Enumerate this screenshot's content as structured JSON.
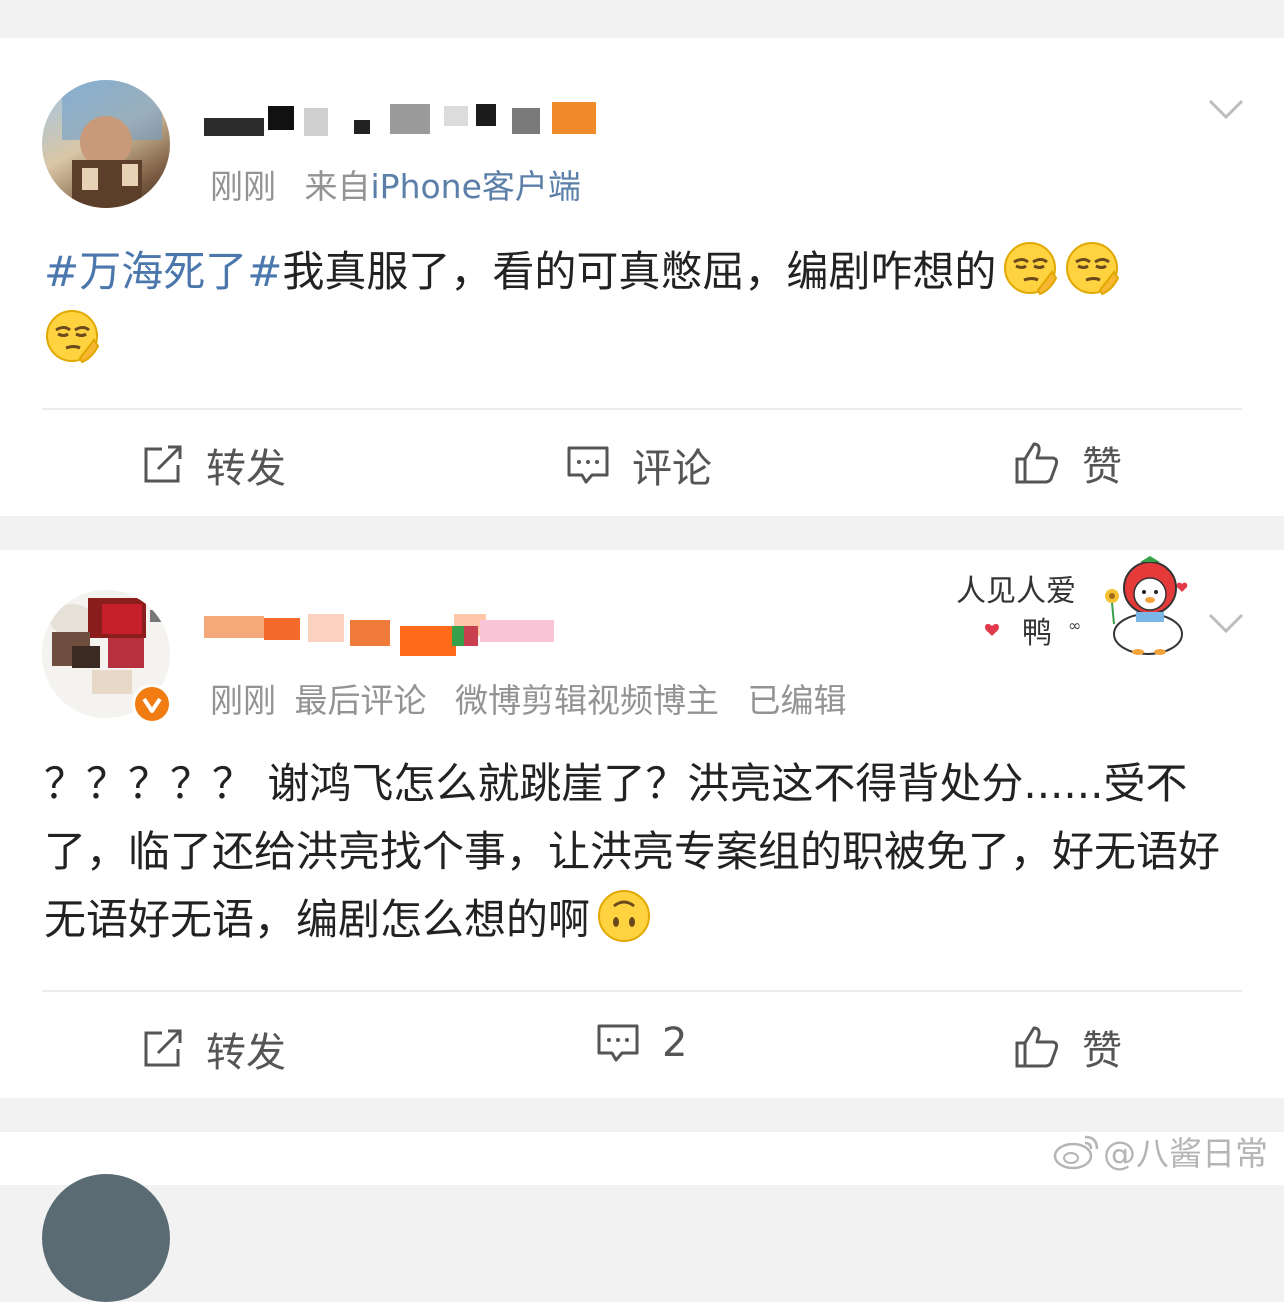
{
  "posts": [
    {
      "meta": {
        "time": "刚刚",
        "from_prefix": "来自",
        "from_source": "iPhone客户端"
      },
      "content": {
        "topic": "#万海死了#",
        "text": "我真服了，看的可真憋屈，编剧咋想的"
      },
      "emoji": {
        "icon": "thinking-squint-emoji",
        "count": 3
      },
      "actions": {
        "repost": "转发",
        "comment": "评论",
        "like": "赞"
      }
    },
    {
      "meta": {
        "time": "刚刚",
        "info": "最后评论",
        "tag": "微博剪辑视频博主",
        "edited": "已编辑"
      },
      "content": {
        "text": "？？？？？ 谢鸿飞怎么就跳崖了？洪亮这不得背处分......受不了，临了还给洪亮找个事，让洪亮专案组的职被免了，好无语好无语好无语，编剧怎么想的啊"
      },
      "emoji": {
        "icon": "upside-down-face-emoji"
      },
      "sticker": {
        "line1": "人见人爱",
        "line2": "鸭",
        "extra": "∞"
      },
      "actions": {
        "repost": "转发",
        "comment": "2",
        "like": "赞"
      }
    }
  ],
  "watermark": {
    "text": "@八酱日常",
    "icon": "weibo-logo-icon"
  },
  "colors": {
    "topic": "#4b77ad",
    "source_link": "#5b7fa8",
    "verified_badge": "#f07c13"
  }
}
